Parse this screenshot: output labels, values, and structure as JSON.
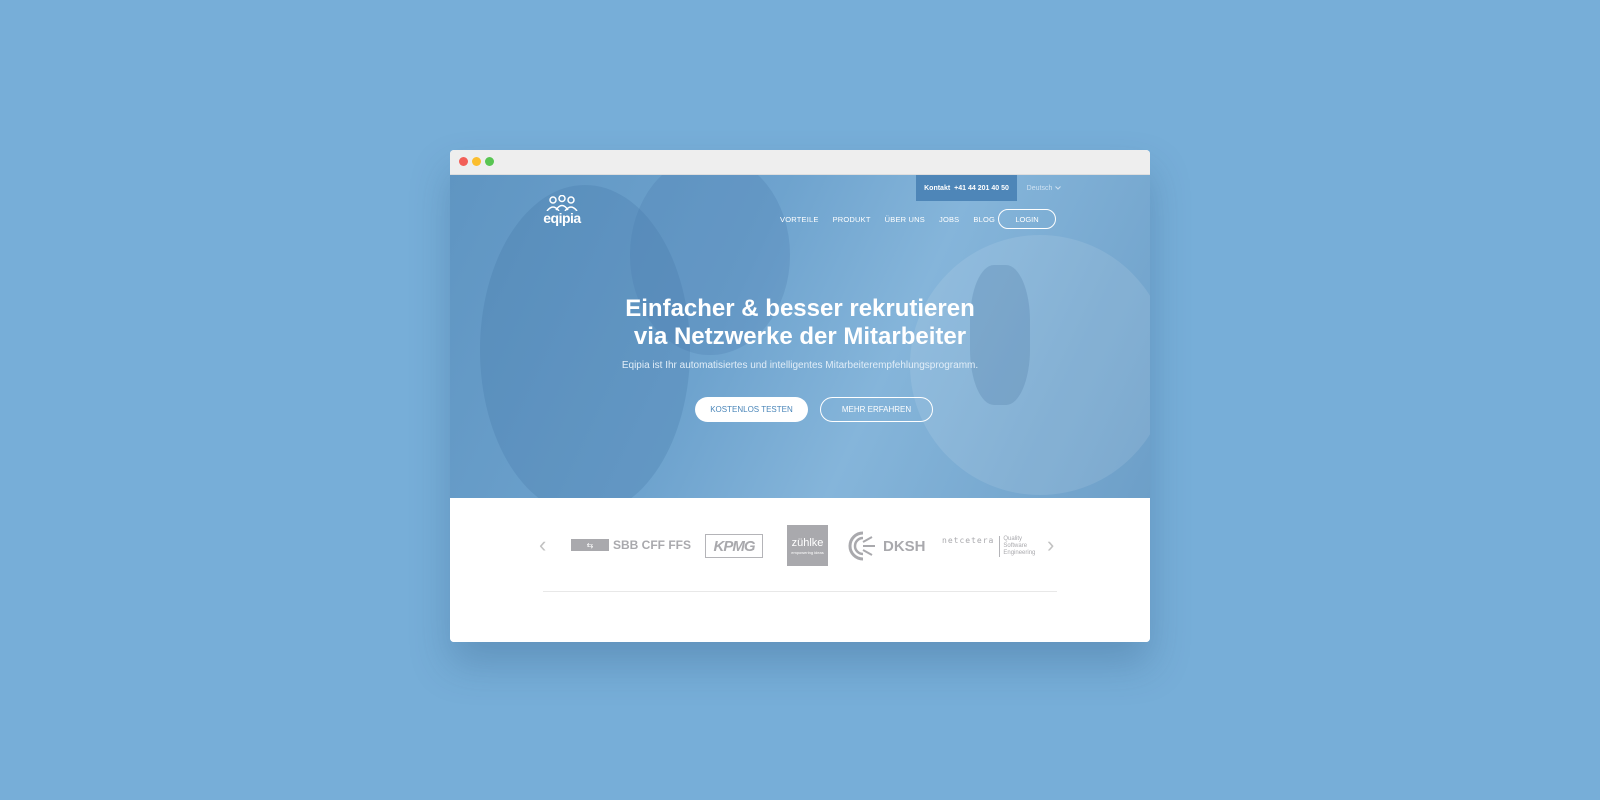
{
  "topbar": {
    "contact_label": "Kontakt",
    "phone": "+41 44 201 40 50",
    "language": "Deutsch"
  },
  "logo": {
    "text": "eqipia"
  },
  "nav": {
    "items": [
      "VORTEILE",
      "PRODUKT",
      "ÜBER UNS",
      "JOBS",
      "BLOG"
    ],
    "login": "LOGIN"
  },
  "hero": {
    "headline_line1": "Einfacher & besser rekrutieren",
    "headline_line2": "via Netzwerke der Mitarbeiter",
    "subline": "Eqipia ist Ihr automatisiertes und intelligentes Mitarbeiterempfehlungsprogramm.",
    "primary_cta": "KOSTENLOS TESTEN",
    "secondary_cta": "MEHR ERFAHREN"
  },
  "clients": {
    "sbb": "SBB CFF FFS",
    "kpmg": "KPMG",
    "zuhlke": "zühlke",
    "zuhlke_tagline": "empowering ideas",
    "dksh": "DKSH",
    "netcetera": "netcetera",
    "netcetera_tagline": [
      "Quality",
      "Software",
      "Engineering"
    ]
  },
  "colors": {
    "page_background": "#77aed8",
    "hero_overlay": "#6ea3ce",
    "primary_button_text": "#4a86b9",
    "client_logo_gray": "#a9a9ad"
  }
}
